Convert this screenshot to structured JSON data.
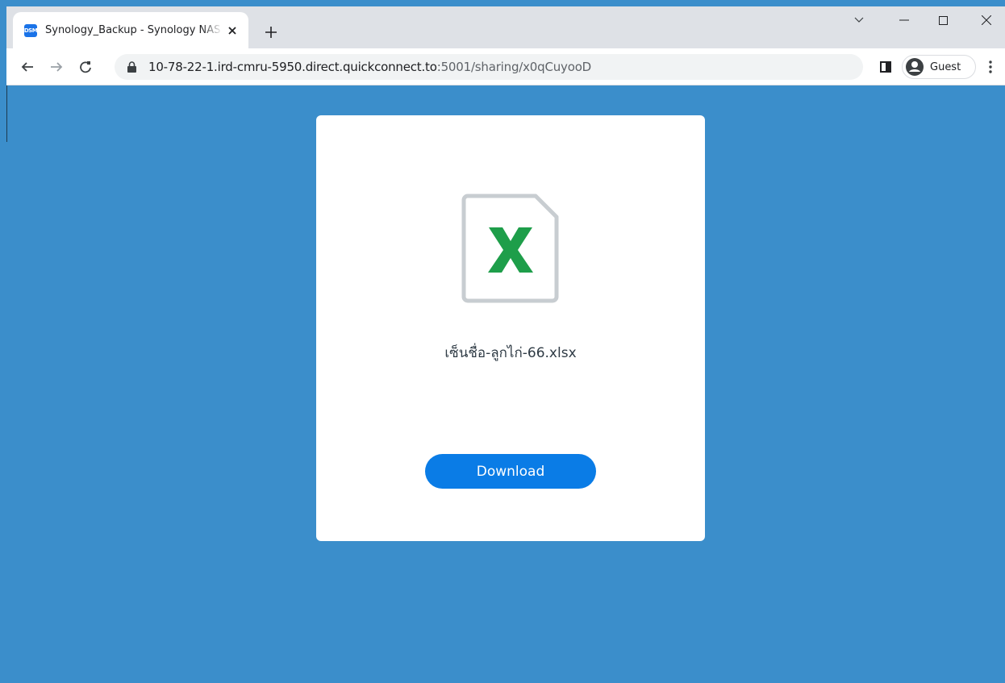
{
  "browser": {
    "tab": {
      "favicon_text": "DSM",
      "title": "Synology_Backup - Synology NAS"
    },
    "address": {
      "host": "10-78-22-1.ird-cmru-5950.direct.quickconnect.to",
      "path": ":5001/sharing/x0qCuyooD"
    },
    "profile_label": "Guest"
  },
  "share": {
    "file_name": "เซ็นชื่อ-ลูกไก่-66.xlsx",
    "file_icon": "excel-file-icon",
    "download_label": "Download"
  },
  "colors": {
    "page_background": "#3b8ecb",
    "download_button": "#0a7ce6",
    "excel_green": "#1e9e4a"
  }
}
